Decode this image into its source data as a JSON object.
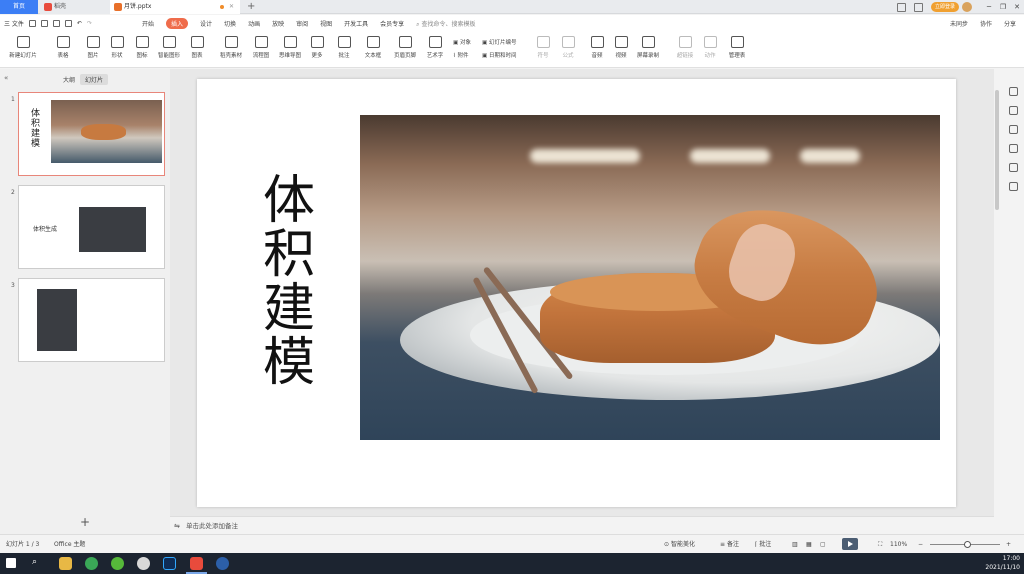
{
  "tabs": {
    "home": "首页",
    "doc": "稻壳",
    "active_file": "月饼.pptx",
    "add": "+"
  },
  "window": {
    "vip_label": "立即登录",
    "minimize": "─",
    "restore": "❐",
    "close": "✕"
  },
  "menu": {
    "file": "三 文件",
    "tabs": [
      "开始",
      "插入",
      "设计",
      "切换",
      "动画",
      "放映",
      "审阅",
      "视图",
      "开发工具",
      "会员专享"
    ],
    "active_tab": "插入",
    "search": "查找命令、搜索模板",
    "right": [
      "未同步",
      "协作",
      "分享"
    ]
  },
  "ribbon": {
    "items": [
      "新建幻灯片",
      "表格",
      "图片",
      "形状",
      "图标",
      "智能图形",
      "图表",
      "稻壳素材",
      "流程图",
      "思维导图",
      "更多",
      "批注",
      "文本框",
      "页眉页脚",
      "艺术字",
      "符号",
      "公式",
      "音频",
      "视频",
      "屏幕录制",
      "超链接",
      "动作",
      "管理表"
    ],
    "small_top": [
      "对象",
      "幻灯片编号"
    ],
    "small_bottom": [
      "附件",
      "日期和时间"
    ]
  },
  "left_panel": {
    "collapse_icon": "«",
    "tab_outline": "大纲",
    "tab_slides": "幻灯片",
    "slides": [
      {
        "num": "1",
        "title": "体积建模"
      },
      {
        "num": "2",
        "title": "体积生成"
      },
      {
        "num": "3",
        "title": ""
      }
    ],
    "add": "+"
  },
  "slide": {
    "title": "体积建模"
  },
  "notes": {
    "placeholder": "单击此处添加备注"
  },
  "status": {
    "slide_count": "幻灯片 1 / 3",
    "theme": "Office 主题",
    "beautify": "智能美化",
    "notes": "备注",
    "comment": "批注",
    "zoom": "110%",
    "zoom_minus": "−",
    "zoom_plus": "+"
  },
  "taskbar": {
    "time": "17:00",
    "date": "2021/11/10"
  },
  "colors": {
    "accent": "#3c7ef5",
    "active_tab": "#ef6c4b",
    "taskbar": "#1c2430"
  }
}
